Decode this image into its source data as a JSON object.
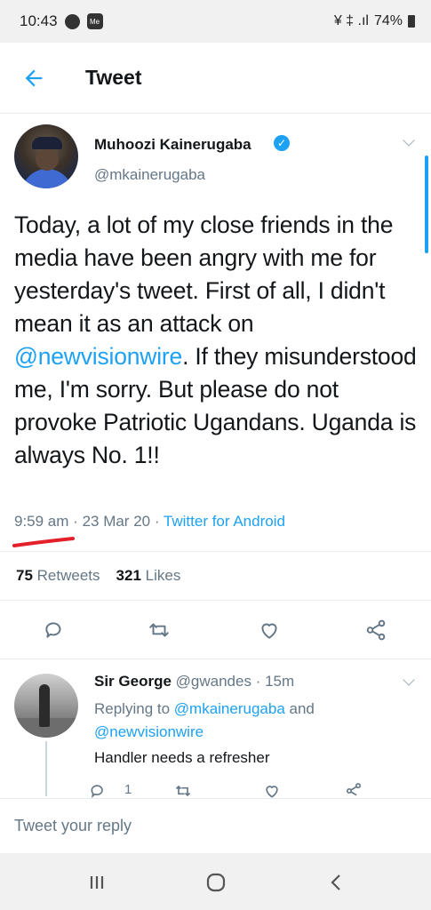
{
  "status_bar": {
    "time": "10:43",
    "signal_text": "¥ ‡ .ıl",
    "battery": "74%"
  },
  "header": {
    "back_icon": "back-arrow-icon",
    "title": "Tweet"
  },
  "tweet": {
    "author_name": "Muhoozi Kainerugaba",
    "author_handle": "@mkainerugaba",
    "text_before": "Today, a lot of my close friends in the media have been angry with me for yesterday's tweet. First of all, I didn't mean it as an attack on ",
    "mention": "@newvisionwire",
    "text_after": ". If they misunderstood me, I'm sorry. But please do not provoke Patriotic Ugandans. Uganda is always No. 1!!",
    "time": "9:59 am",
    "date": "23 Mar 20",
    "source": "Twitter for Android",
    "retweets_count": "75",
    "retweets_label": "Retweets",
    "likes_count": "321",
    "likes_label": "Likes"
  },
  "reply": {
    "name": "Sir George",
    "handle": "@gwandes",
    "age": "15m",
    "replying_prefix": "Replying to ",
    "replying_mention_1": "@mkainerugaba",
    "replying_and": " and",
    "replying_mention_2": "@newvisionwire",
    "text": "Handler needs a refresher",
    "reply_count": "1"
  },
  "compose": {
    "placeholder": "Tweet your reply"
  },
  "colors": {
    "accent": "#1da1f2",
    "secondary_text": "#657786",
    "annotation_underline": "#e3202a"
  }
}
